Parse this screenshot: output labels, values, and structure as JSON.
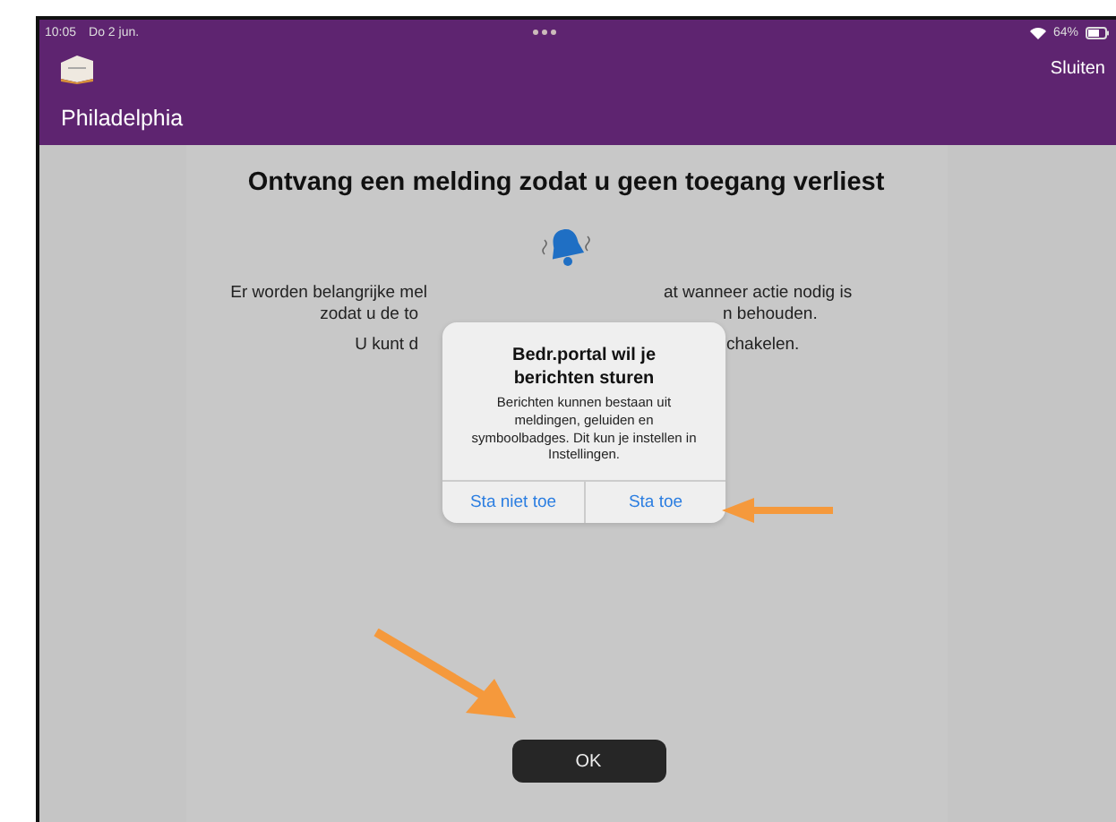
{
  "status_bar": {
    "time": "10:05",
    "date": "Do 2 jun.",
    "battery": "64%"
  },
  "nav_bar": {
    "close_button": "Sluiten",
    "title": "Philadelphia"
  },
  "page": {
    "heading": "Ontvang een melding zodat u geen toegang verliest",
    "body_lines": [
      {
        "left": "Er worden belangrijke mel",
        "right": "at wanneer actie nodig is"
      },
      {
        "left": "zodat u de to",
        "right": "n behouden."
      },
      {
        "left": "U kunt d",
        "right": "chakelen."
      }
    ],
    "ok_button": "OK"
  },
  "alert": {
    "title": "Bedr.portal wil je berichten sturen",
    "message": "Berichten kunnen bestaan uit meldingen, geluiden en symboolbadges. Dit kun je instellen in Instellingen.",
    "buttons": [
      "Sta niet toe",
      "Sta toe"
    ]
  }
}
